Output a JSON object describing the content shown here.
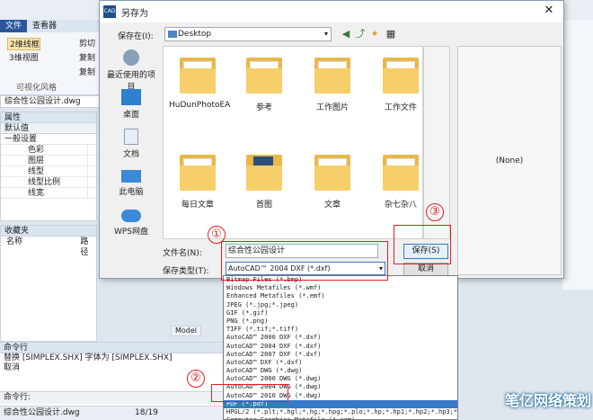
{
  "app": {
    "ribbon_tabs": [
      "文件",
      "查看器"
    ],
    "ribbon_buttons": [
      "2维线框",
      "3维视图",
      "剪切",
      "复制",
      "复制"
    ],
    "ribbon_group": "可视化风格",
    "drawing_tab": "综合性公园设计.dwg",
    "props_header": "属性",
    "props_default": "默认值",
    "props_group": "一般设置",
    "props_rows": [
      "色彩",
      "图层",
      "线型",
      "线型比例",
      "线宽"
    ],
    "fav_header": "收藏夹",
    "fav_columns": [
      "名称",
      "路径"
    ],
    "model_tab": "Model",
    "cmd_header": "命令行",
    "cmd_lines": [
      "替换 [SIMPLEX.SHX] 字体为 [SIMPLEX.SHX]",
      "取消"
    ],
    "cmd_prompt": "命令行:",
    "status_file": "综合性公园设计.dwg",
    "status_page": "18/19"
  },
  "dialog": {
    "title": "另存为",
    "save_in_label": "保存在(I):",
    "save_in_value": "Desktop",
    "places": [
      "最近使用的项目",
      "桌面",
      "文档",
      "此电脑",
      "WPS网盘"
    ],
    "folders": [
      "HuDunPhotoEA",
      "参考",
      "工作图片",
      "工作文件",
      "每日文章",
      "首图",
      "文章",
      "杂七杂八"
    ],
    "preview_text": "(None)",
    "filename_label": "文件名(N):",
    "filename_value": "综合性公园设计",
    "filetype_label": "保存类型(T):",
    "filetype_value": "AutoCAD™ 2004 DXF (*.dxf)",
    "save_button": "保存(S)",
    "cancel_button": "取消",
    "filetype_options": [
      "Bitmap Files (*.bmp)",
      "Windows Metafiles (*.wmf)",
      "Enhanced Metafiles (*.emf)",
      "JPEG (*.jpg;*.jpeg)",
      "GIF (*.gif)",
      "PNG (*.png)",
      "TIFF (*.tif;*.tiff)",
      "AutoCAD™ 2000 DXF (*.dxf)",
      "AutoCAD™ 2004 DXF (*.dxf)",
      "AutoCAD™ 2007 DXF (*.dxf)",
      "AutoCAD™ DXF (*.dxf)",
      "AutoCAD™ DWG (*.dwg)",
      "AutoCAD™ 2000 DWG (*.dwg)",
      "AutoCAD™ 2004 DWG (*.dwg)",
      "AutoCAD™ 2010 DWG (*.dwg)",
      "PDF (*.pdf)",
      "HPGL/2 (*.plt;*.hgl;*.hg;*.hpg;*.plo;*.hp;*.hp1;*.hp2;*.hp3;*.hpgl",
      "Computer Graphics Metafile (*.cgm)",
      "SCode (*.ps;*.psz;*.scode)"
    ],
    "selected_option_index": 15
  },
  "annotations": [
    "①",
    "②",
    "③"
  ],
  "colors": {
    "annotation": "#e02020",
    "selection": "#3778c8",
    "folder": "#f6cf6a"
  },
  "watermark": "笔亿网络策划"
}
